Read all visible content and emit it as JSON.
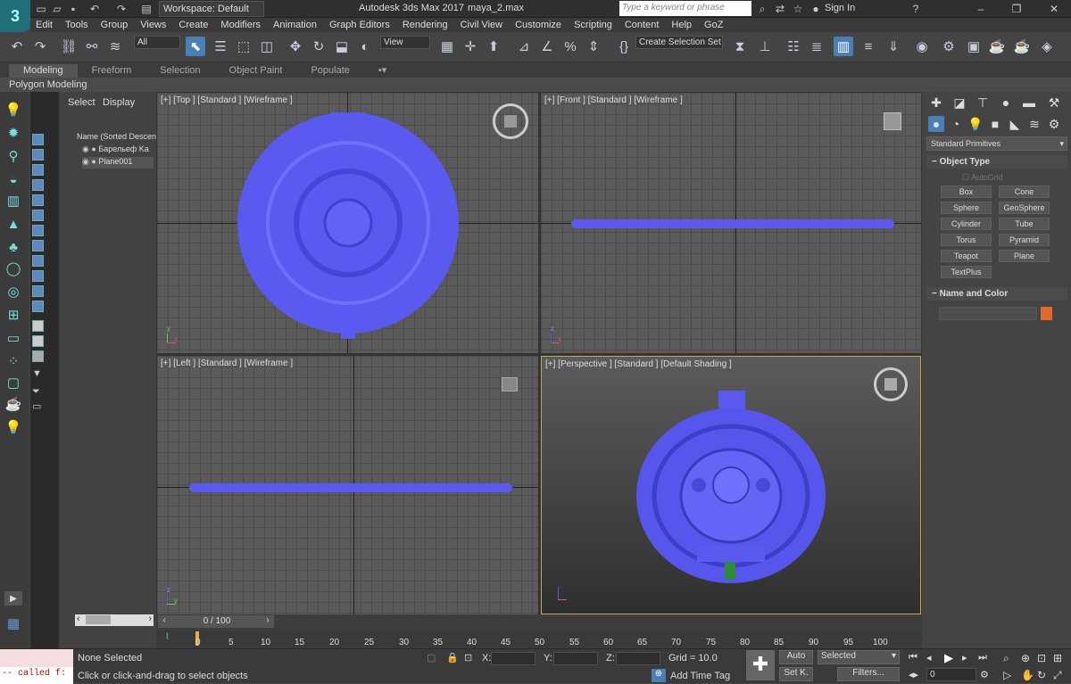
{
  "title": {
    "app": "Autodesk 3ds Max 2017",
    "file": "maya_2.max",
    "workspace": "Workspace: Default",
    "search_placeholder": "Type a keyword or phrase",
    "sign_in": "Sign In"
  },
  "logo": "3",
  "menu": [
    "Edit",
    "Tools",
    "Group",
    "Views",
    "Create",
    "Modifiers",
    "Animation",
    "Graph Editors",
    "Rendering",
    "Civil View",
    "Customize",
    "Scripting",
    "Content",
    "Help",
    "GoZ"
  ],
  "toolbar": {
    "filter": "All",
    "ref_coord": "View",
    "selection_set": "Create Selection Set"
  },
  "ribbon": {
    "tabs": [
      "Modeling",
      "Freeform",
      "Selection",
      "Object Paint",
      "Populate"
    ],
    "panel": "Polygon Modeling"
  },
  "scene_explorer": {
    "tabs": [
      "Select",
      "Display"
    ],
    "header": "Name (Sorted Descen",
    "items": [
      "Барельеф Ka",
      "Plane001"
    ]
  },
  "viewports": {
    "top": "[+] [Top ] [Standard ] [Wireframe ]",
    "front": "[+] [Front ] [Standard ] [Wireframe ]",
    "left": "[+] [Left ] [Standard ] [Wireframe ]",
    "perspective": "[+] [Perspective ] [Standard ] [Default Shading ]"
  },
  "command_panel": {
    "category": "Standard Primitives",
    "object_type_title": "Object Type",
    "autogrid": "AutoGrid",
    "buttons": [
      "Box",
      "Cone",
      "Sphere",
      "GeoSphere",
      "Cylinder",
      "Tube",
      "Torus",
      "Pyramid",
      "Teapot",
      "Plane",
      "TextPlus"
    ],
    "name_color_title": "Name and Color",
    "object_color": "#e06a2b"
  },
  "timeline": {
    "frame": "0 / 100",
    "ticks": [
      "0",
      "5",
      "10",
      "15",
      "20",
      "25",
      "30",
      "35",
      "40",
      "45",
      "50",
      "55",
      "60",
      "65",
      "70",
      "75",
      "80",
      "85",
      "90",
      "95",
      "100"
    ]
  },
  "status": {
    "selection": "None Selected",
    "prompt": "Click or click-and-drag to select objects",
    "maxscript": "-- called f:",
    "x_label": "X:",
    "y_label": "Y:",
    "z_label": "Z:",
    "grid": "Grid = 10.0",
    "add_time_tag": "Add Time Tag",
    "auto": "Auto",
    "set_key": "Set K.",
    "key_mode": "Selected",
    "filters": "Filters...",
    "current_frame": "0"
  },
  "colors": {
    "mesh": "#5a5af0",
    "active_border": "#c7a84a"
  }
}
